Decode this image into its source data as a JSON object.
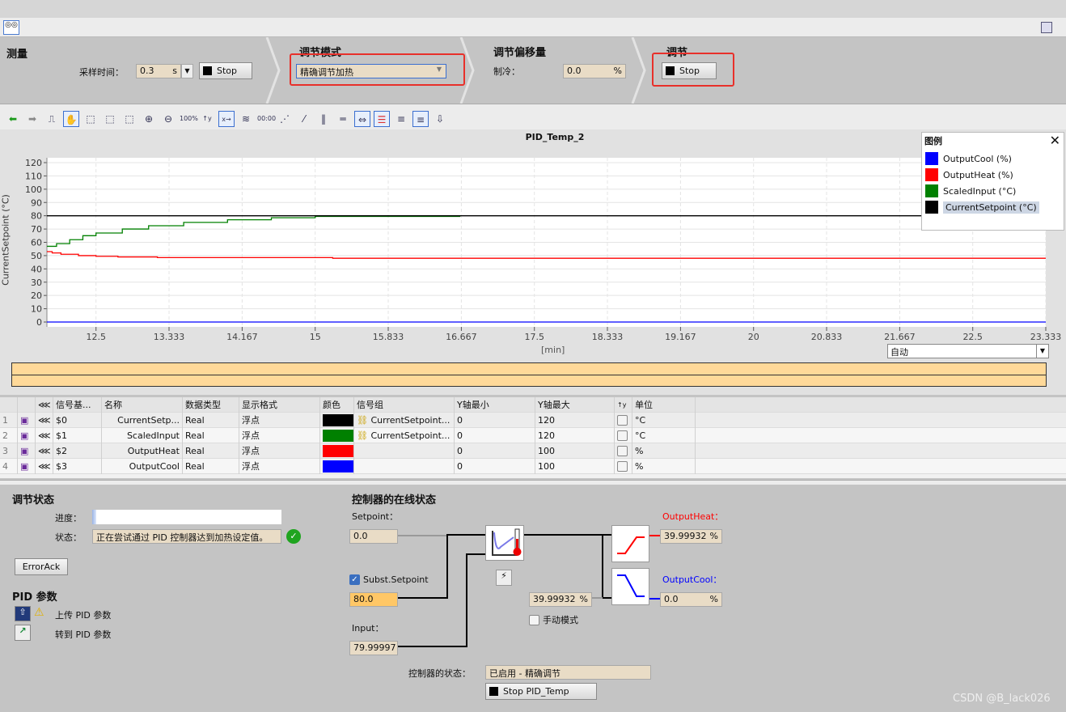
{
  "header": {
    "measure": {
      "title": "测量",
      "sample_label": "采样时间：",
      "sample_value": "0.3",
      "sample_unit": "s",
      "stop_label": "Stop"
    },
    "mode": {
      "title": "调节模式",
      "selected": "精确调节加热"
    },
    "offset": {
      "title": "调节偏移量",
      "cool_label": "制冷：",
      "cool_value": "0.0",
      "cool_unit": "%"
    },
    "tune": {
      "title": "调节",
      "stop_label": "Stop"
    }
  },
  "chart_data": {
    "type": "line",
    "title": "PID_Temp_2",
    "xlabel": "[min]",
    "ylabel": "CurrentSetpoint (°C)",
    "xlim": [
      11.94,
      23.333
    ],
    "ylim": [
      0,
      120
    ],
    "xticks": [
      "12.5",
      "13.333",
      "14.167",
      "15",
      "15.833",
      "16.667",
      "17.5",
      "18.333",
      "19.167",
      "20",
      "20.833",
      "21.667",
      "22.5",
      "23.333"
    ],
    "yticks": [
      "0",
      "10",
      "20",
      "30",
      "40",
      "50",
      "60",
      "70",
      "80",
      "90",
      "100",
      "110",
      "120"
    ],
    "grid": true,
    "series": [
      {
        "name": "OutputCool (%)",
        "color": "#0000ff",
        "points": [
          [
            11.94,
            0
          ],
          [
            23.333,
            0
          ]
        ]
      },
      {
        "name": "OutputHeat (%)",
        "color": "#ff0000",
        "points": [
          [
            11.94,
            53
          ],
          [
            12.0,
            52
          ],
          [
            12.1,
            51
          ],
          [
            12.3,
            50
          ],
          [
            12.5,
            49.5
          ],
          [
            12.75,
            49
          ],
          [
            13.2,
            48.5
          ],
          [
            15.2,
            48
          ],
          [
            23.333,
            48
          ]
        ]
      },
      {
        "name": "ScaledInput (°C)",
        "color": "#008000",
        "points": [
          [
            11.94,
            57
          ],
          [
            12.05,
            59
          ],
          [
            12.2,
            62
          ],
          [
            12.35,
            65
          ],
          [
            12.5,
            67
          ],
          [
            12.8,
            70
          ],
          [
            13.1,
            72.5
          ],
          [
            13.5,
            75
          ],
          [
            14.0,
            77
          ],
          [
            14.5,
            78.5
          ],
          [
            15.0,
            79.5
          ],
          [
            16.65,
            79.7
          ]
        ]
      },
      {
        "name": "CurrentSetpoint (°C)",
        "color": "#000000",
        "points": [
          [
            11.94,
            80
          ],
          [
            23.333,
            80
          ]
        ]
      }
    ],
    "legend_title": "图例",
    "legend_position": "top-right",
    "time_range_select": "自动"
  },
  "table": {
    "headers": [
      "信号基...",
      "名称",
      "数据类型",
      "显示格式",
      "颜色",
      "信号组",
      "Y轴最小",
      "Y轴最大",
      "单位"
    ],
    "rows": [
      {
        "n": "1",
        "addr": "$0",
        "name": "CurrentSetp...",
        "type": "Real",
        "fmt": "浮点",
        "color": "#000000",
        "group": "CurrentSetpoint...",
        "ymin": "0",
        "ymax": "120",
        "unit": "°C"
      },
      {
        "n": "2",
        "addr": "$1",
        "name": "ScaledInput",
        "type": "Real",
        "fmt": "浮点",
        "color": "#008000",
        "group": "CurrentSetpoint...",
        "ymin": "0",
        "ymax": "120",
        "unit": "°C"
      },
      {
        "n": "3",
        "addr": "$2",
        "name": "OutputHeat",
        "type": "Real",
        "fmt": "浮点",
        "color": "#ff0000",
        "group": "",
        "ymin": "0",
        "ymax": "100",
        "unit": "%"
      },
      {
        "n": "4",
        "addr": "$3",
        "name": "OutputCool",
        "type": "Real",
        "fmt": "浮点",
        "color": "#0000ff",
        "group": "",
        "ymin": "0",
        "ymax": "100",
        "unit": "%"
      }
    ]
  },
  "status": {
    "title": "调节状态",
    "progress_label": "进度：",
    "progress": 2,
    "state_label": "状态：",
    "state_value": "正在尝试通过 PID 控制器达到加热设定值。",
    "errorack": "ErrorAck"
  },
  "pid": {
    "title": "PID 参数",
    "upload": "上传 PID 参数",
    "goto": "转到 PID 参数"
  },
  "online": {
    "title": "控制器的在线状态",
    "setpoint_label": "Setpoint：",
    "setpoint_value": "0.0",
    "subst_label": "Subst.Setpoint",
    "subst_checked": true,
    "subst_value": "80.0",
    "input_label": "Input：",
    "input_value": "79.99997",
    "output_value": "39.99932",
    "output_unit": "%",
    "manual_label": "手动模式",
    "heat_label": "OutputHeat：",
    "heat_value": "39.99932",
    "heat_unit": "%",
    "cool_label": "OutputCool：",
    "cool_value": "0.0",
    "cool_unit": "%",
    "ctrl_state_label": "控制器的状态：",
    "ctrl_state_value": "已启用 - 精确调节",
    "stop_label": "Stop PID_Temp"
  },
  "watermark": "CSDN @B_lack026"
}
